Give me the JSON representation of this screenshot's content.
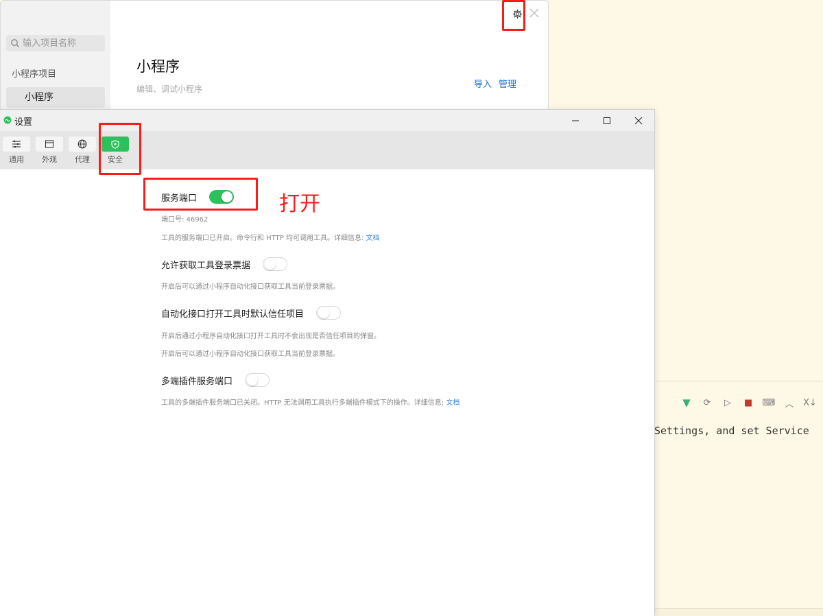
{
  "project_window": {
    "search_placeholder": "输入项目名称",
    "sidebar_section": "小程序项目",
    "sidebar_item": "小程序",
    "title": "小程序",
    "subtitle": "编辑、调试小程序",
    "actions": {
      "import": "导入",
      "manage": "管理"
    }
  },
  "settings": {
    "title": "设置",
    "tabs": [
      {
        "label": "通用",
        "icon": "list-icon"
      },
      {
        "label": "外观",
        "icon": "window-icon"
      },
      {
        "label": "代理",
        "icon": "globe-icon"
      },
      {
        "label": "安全",
        "icon": "shield-icon",
        "active": true
      }
    ],
    "service_port": {
      "label": "服务端口",
      "enabled": true,
      "port_text": "端口号: 46962",
      "desc": "工具的服务端口已开启。命令行和 HTTP 均可调用工具。详细信息:",
      "link": "文档"
    },
    "allow_login_ticket": {
      "label": "允许获取工具登录票据",
      "enabled": false,
      "desc": "开启后可以通过小程序自动化接口获取工具当前登录票据。"
    },
    "auto_trust": {
      "label": "自动化接口打开工具时默认信任项目",
      "enabled": false,
      "desc1": "开启后通过小程序自动化接口打开工具时不会出现是否信任项目的弹窗。",
      "desc2": "开启后可以通过小程序自动化接口获取工具当前登录票据。"
    },
    "multi_plugin_port": {
      "label": "多端插件服务端口",
      "enabled": false,
      "desc": "工具的多端插件服务端口已关闭。HTTP 无法调用工具执行多端插件模式下的操作。详细信息:",
      "link": "文档"
    }
  },
  "annotation": {
    "text": "打开",
    "color": "#ff1a1a"
  },
  "editor": {
    "text": "Settings, and set Service",
    "toolbar_last": "X↓"
  },
  "colors": {
    "accent_green": "#2ec05c",
    "link_blue": "#3a84d6",
    "annotation_red": "#ff1a1a"
  }
}
